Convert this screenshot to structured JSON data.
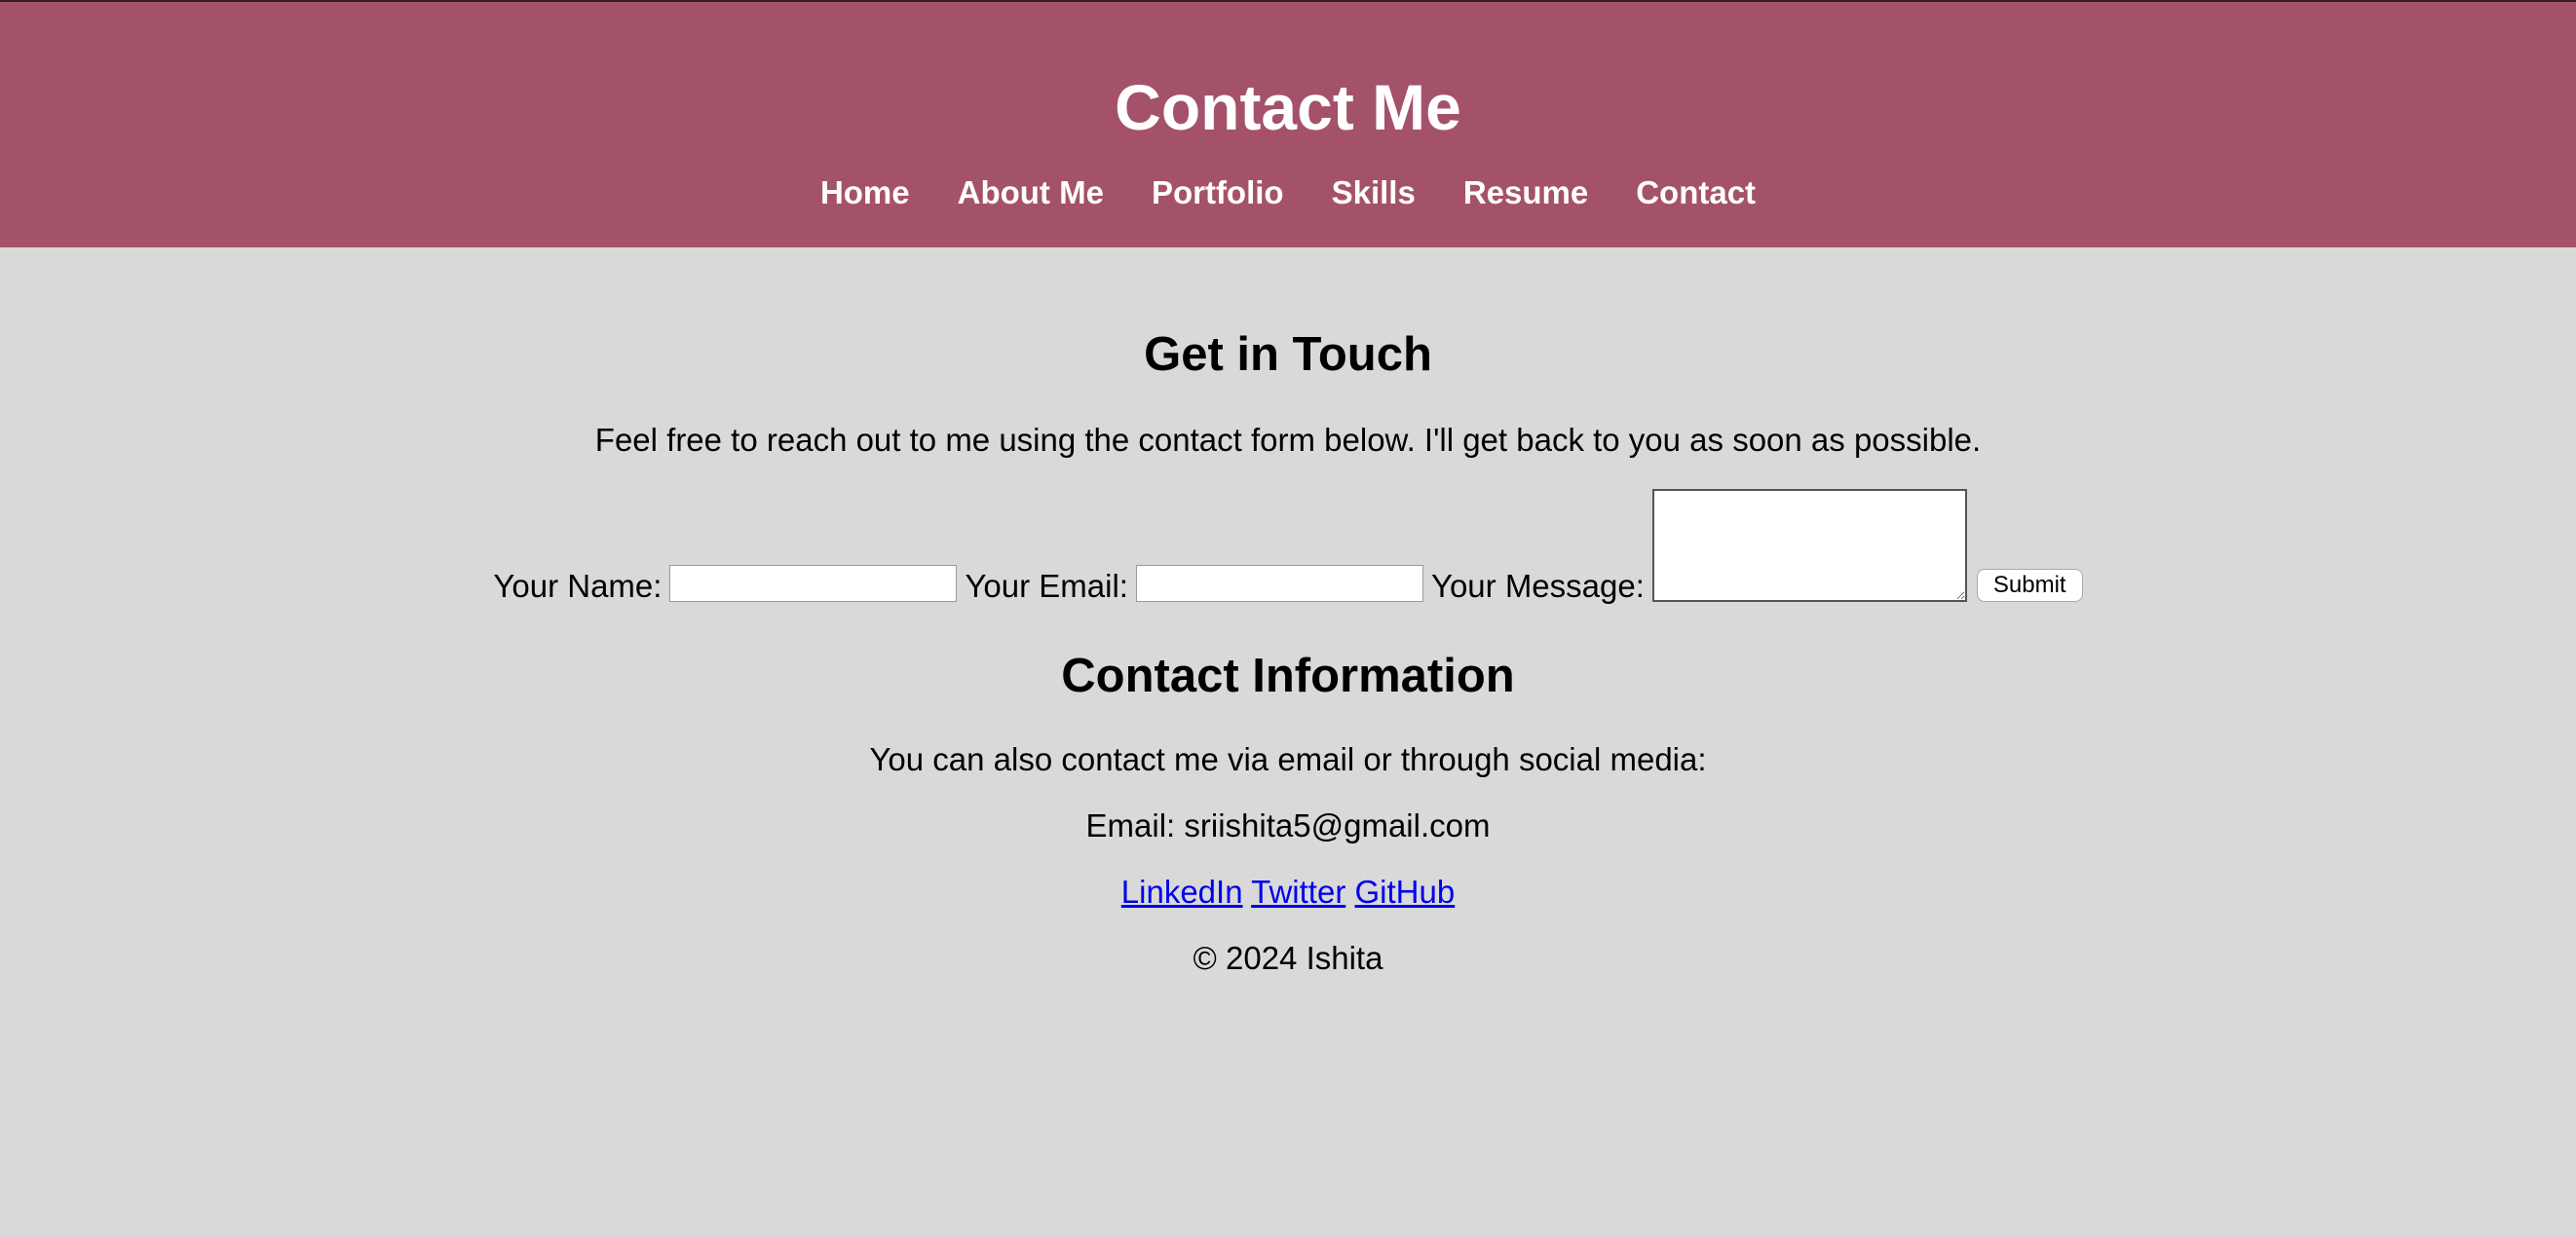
{
  "header": {
    "title": "Contact Me",
    "nav": [
      {
        "label": "Home"
      },
      {
        "label": "About Me"
      },
      {
        "label": "Portfolio"
      },
      {
        "label": "Skills"
      },
      {
        "label": "Resume"
      },
      {
        "label": "Contact"
      }
    ]
  },
  "touch": {
    "title": "Get in Touch",
    "intro": "Feel free to reach out to me using the contact form below. I'll get back to you as soon as possible."
  },
  "form": {
    "name_label": "Your Name:",
    "name_value": "",
    "email_label": "Your Email:",
    "email_value": "",
    "message_label": "Your Message:",
    "message_value": "",
    "submit_label": "Submit"
  },
  "info": {
    "title": "Contact Information",
    "text": "You can also contact me via email or through social media:",
    "email": "Email: sriishita5@gmail.com",
    "links": [
      {
        "label": "LinkedIn"
      },
      {
        "label": "Twitter"
      },
      {
        "label": "GitHub"
      }
    ],
    "copyright": "© 2024 Ishita"
  },
  "colors": {
    "header_bg": "#a45269",
    "page_bg": "#d9d9d9",
    "link": "#0000ee"
  }
}
